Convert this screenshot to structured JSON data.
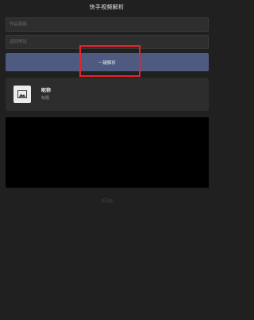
{
  "app": {
    "title": "快手视频解析"
  },
  "form": {
    "link_placeholder": "作品链接",
    "result_placeholder": "返回地址",
    "submit_label": "一键解析"
  },
  "profile": {
    "name": "昵称",
    "subtitle": "标题"
  },
  "footer": {
    "note": "本页面"
  },
  "colors": {
    "background": "#202020",
    "button": "#4f5a80",
    "highlight": "#e8232a",
    "player": "#000000"
  },
  "icons": {
    "avatar": "image-placeholder-icon"
  }
}
